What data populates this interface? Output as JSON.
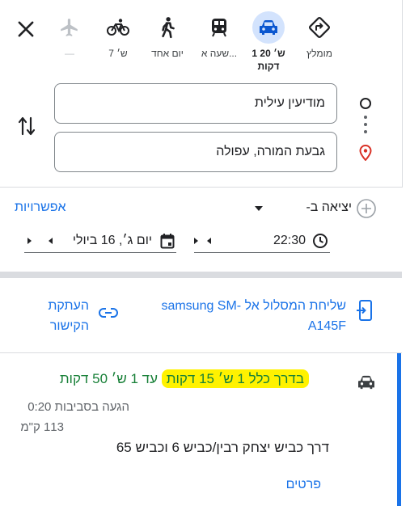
{
  "travel_modes": [
    {
      "name": "best",
      "label": "מומלץ"
    },
    {
      "name": "driving",
      "label": "1 ש׳ 20",
      "label2": "דקות",
      "active": true
    },
    {
      "name": "transit",
      "label": "שעה א..."
    },
    {
      "name": "walking",
      "label": "יום אחד"
    },
    {
      "name": "cycling",
      "label": "7 ש׳"
    },
    {
      "name": "flight",
      "label": "—"
    }
  ],
  "origin": {
    "value": "מודיעין עילית"
  },
  "destination": {
    "value": "גבעת המורה, עפולה"
  },
  "depart": {
    "label": "יציאה ב-",
    "options_link": "אפשרויות",
    "time": "22:30",
    "date": "יום ג׳, 16 ביולי"
  },
  "share": {
    "send_label": "שליחת המסלול אל samsung SM-A145F",
    "copy_link_label": "העתקת הקישור"
  },
  "route": {
    "summary": "עד 1 ש׳ 50 דקות",
    "highlight": "בדרך כלל 1 ש׳ 15 דקות",
    "arrival": "הגעה בסביבות 0:20",
    "distance": "113 ק\"מ",
    "via": "דרך כביש יצחק רבין/כביש 6 וכביש 65",
    "details_link": "פרטים"
  },
  "colors": {
    "accent": "#1a73e8",
    "route_green": "#188038",
    "highlight": "#fff200",
    "error_red": "#d93025"
  }
}
